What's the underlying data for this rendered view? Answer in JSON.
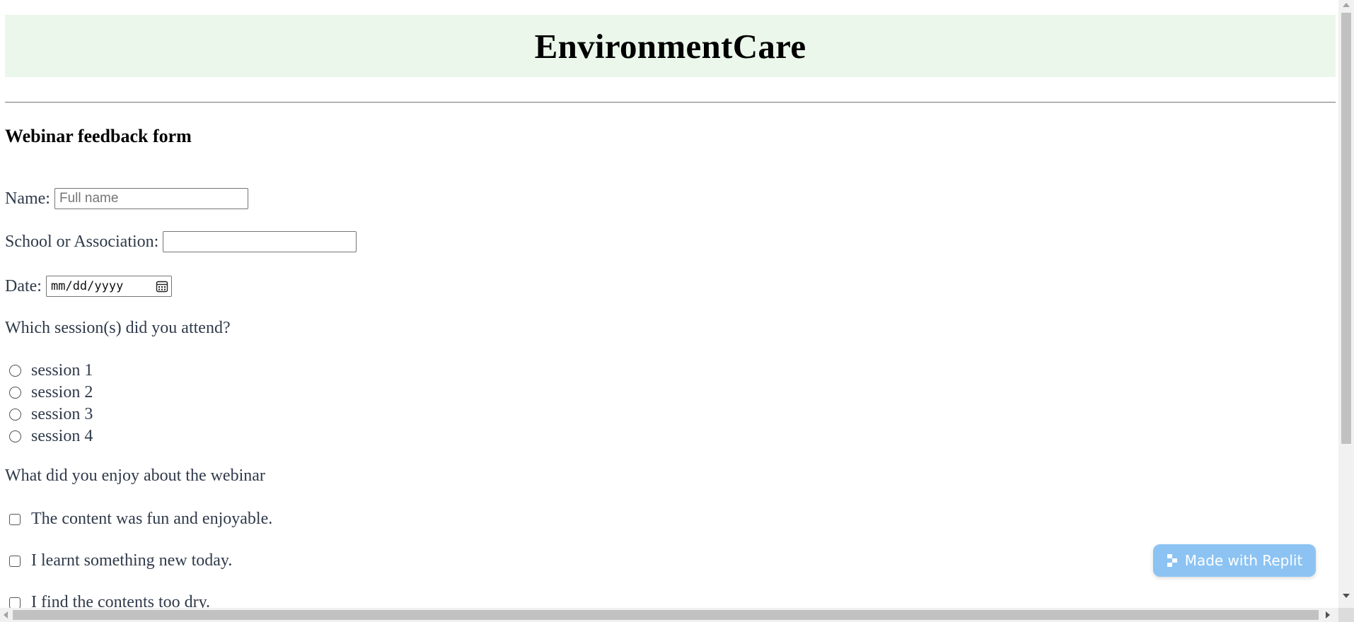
{
  "header": {
    "title": "EnvironmentCare"
  },
  "form": {
    "title": "Webinar feedback form",
    "name_label": "Name:",
    "name_placeholder": "Full name",
    "name_value": "",
    "school_label": "School or Association:",
    "school_value": "",
    "date_label": "Date:",
    "date_value": "mm/dd/yyyy",
    "sessions_question": "Which session(s) did you attend?",
    "sessions": [
      {
        "label": "session 1",
        "selected": false
      },
      {
        "label": "session 2",
        "selected": false
      },
      {
        "label": "session 3",
        "selected": false
      },
      {
        "label": "session 4",
        "selected": false
      }
    ],
    "enjoy_question": "What did you enjoy about the webinar",
    "enjoy_options": [
      {
        "label": "The content was fun and enjoyable.",
        "checked": false
      },
      {
        "label": "I learnt something new today.",
        "checked": false
      },
      {
        "label": "I find the contents too dry.",
        "checked": false
      }
    ]
  },
  "badge": {
    "label": "Made with Replit",
    "icon": "replit-logo-icon"
  },
  "colors": {
    "header_band": "#ebf7ea",
    "text": "#2f3a4a",
    "badge_bg": "#8cc3f3"
  }
}
